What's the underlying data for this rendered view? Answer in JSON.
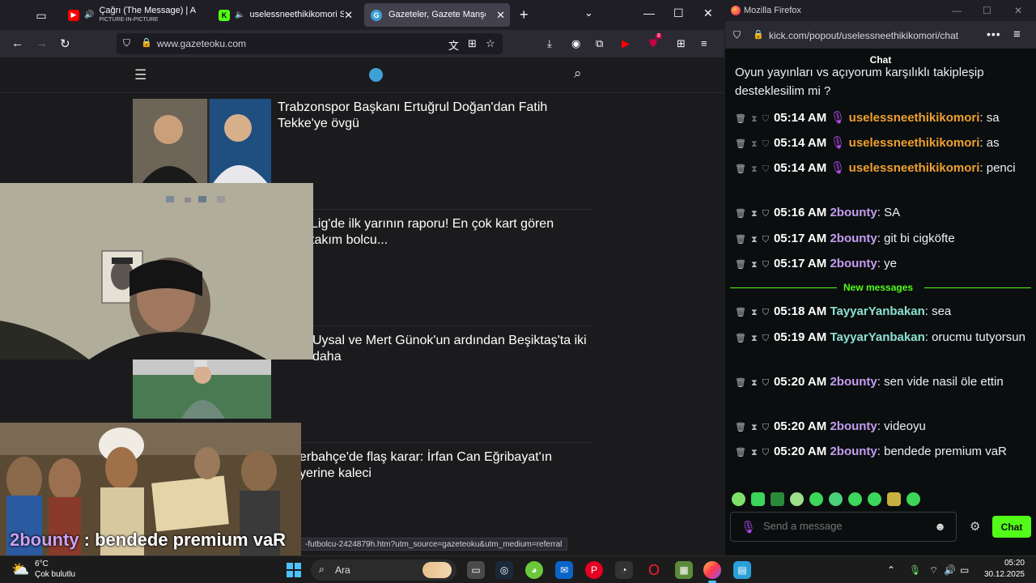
{
  "left_browser": {
    "tabs": [
      {
        "title": "Çağrı (The Message) | Allah",
        "subtitle": "PICTURE-IN-PICTURE",
        "active": false
      },
      {
        "title": "uselessneethikikomori Strea",
        "active": false
      },
      {
        "title": "Gazeteler, Gazete Manşetleri - G",
        "active": true
      }
    ],
    "url": "www.gazeteoku.com",
    "status_url": "-futbolcu-2424879h.htm?utm_source=gazeteoku&utm_medium=referral",
    "articles": [
      {
        "title": "Trabzonspor Başkanı Ertuğrul Doğan'dan Fatih Tekke'ye övgü"
      },
      {
        "title": "Lig'de ilk yarının raporu! En çok kart gören takım bolcu..."
      },
      {
        "title": "Uysal ve Mert Günok'un ardından Beşiktaş'ta iki daha"
      },
      {
        "title": "erbahçe'de flaş karar: İrfan Can Eğribayat'ın yerine kaleci"
      }
    ]
  },
  "pip_caption": {
    "username": "2bounty",
    "text": " : bendede premium vaR"
  },
  "right_browser": {
    "window_title": "Mozilla Firefox",
    "url": "kick.com/popout/uselessneethikikomori/chat",
    "chat_title": "Chat",
    "partial_message": "Oyun yayınları vs açıyorum karşılıklı takipleşip desteklesilim mi ?",
    "messages": [
      {
        "time": "05:14 AM",
        "user": "uselessneethikikomori",
        "text": "sa",
        "mic": true,
        "dim": true
      },
      {
        "time": "05:14 AM",
        "user": "uselessneethikikomori",
        "text": "as",
        "mic": true,
        "dim": true
      },
      {
        "time": "05:14 AM",
        "user": "uselessneethikikomori",
        "text": "penci",
        "mic": true,
        "dim": true
      },
      {
        "time": "05:16 AM",
        "user": "2bounty",
        "text": "SA",
        "mic": false,
        "dim": false
      },
      {
        "time": "05:17 AM",
        "user": "2bounty",
        "text": "git bi cigköfte",
        "mic": false,
        "dim": false
      },
      {
        "time": "05:17 AM",
        "user": "2bounty",
        "text": "ye",
        "mic": false,
        "dim": false
      },
      {
        "time": "05:18 AM",
        "user": "TayyarYanbakan",
        "text": "sea",
        "mic": false,
        "dim": false
      },
      {
        "time": "05:19 AM",
        "user": "TayyarYanbakan",
        "text": "orucmu tutyorsun",
        "mic": false,
        "dim": false
      },
      {
        "time": "05:20 AM",
        "user": "2bounty",
        "text": "sen vide nasil öle ettin",
        "mic": false,
        "dim": false
      },
      {
        "time": "05:20 AM",
        "user": "2bounty",
        "text": "videoyu",
        "mic": false,
        "dim": false
      },
      {
        "time": "05:20 AM",
        "user": "2bounty",
        "text": "bendede premium vaR",
        "mic": false,
        "dim": false
      }
    ],
    "new_messages_label": "New messages",
    "input_placeholder": "Send a message",
    "send_label": "Chat"
  },
  "taskbar": {
    "weather_temp": "6°C",
    "weather_cond": "Çok bulutlu",
    "search_label": "Ara",
    "time": "05:20",
    "date": "30.12.2025"
  },
  "colors": {
    "kick_green": "#53fc18",
    "accent_blue": "#4cc2ff",
    "user_useless": "#f0a030",
    "user_bounty": "#c39cf0",
    "user_tayyar": "#8ce0d0"
  }
}
